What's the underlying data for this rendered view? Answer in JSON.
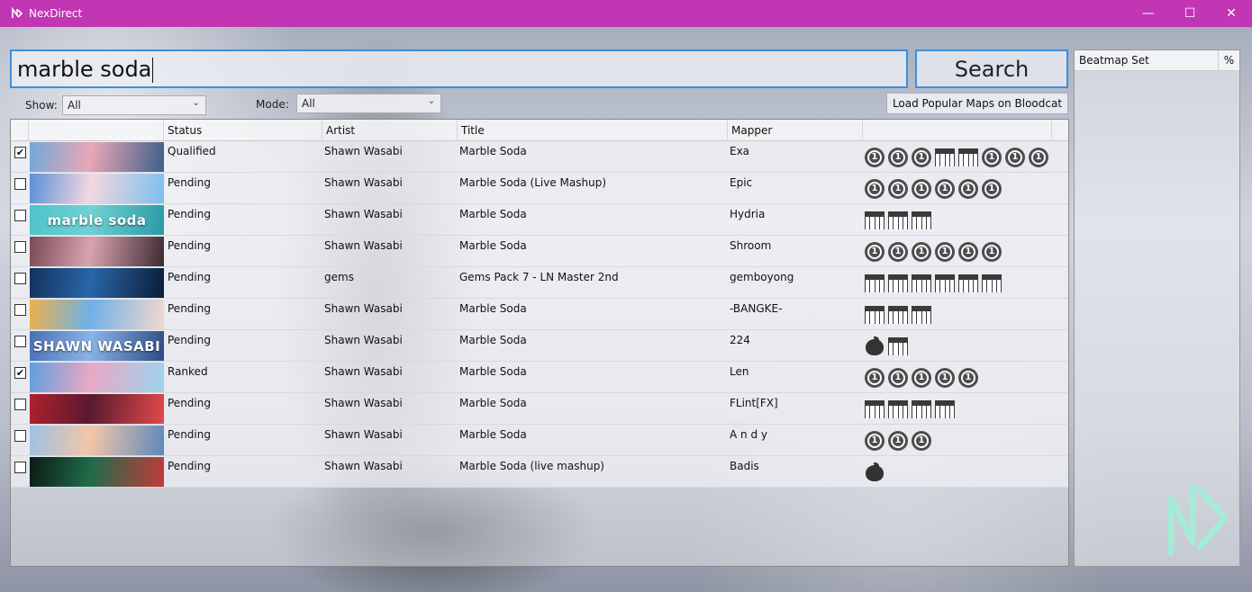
{
  "window": {
    "title": "NexDirect",
    "minimize": "—",
    "maximize": "☐",
    "close": "✕"
  },
  "search": {
    "value": "marble soda",
    "button_label": "Search"
  },
  "filters": {
    "show_label": "Show:",
    "show_value": "All",
    "mode_label": "Mode:",
    "mode_value": "All",
    "load_popular_label": "Load Popular Maps on Bloodcat"
  },
  "grid": {
    "columns": [
      "Status",
      "Artist",
      "Title",
      "Mapper"
    ],
    "rows": [
      {
        "checked": true,
        "status": "Qualified",
        "artist": "Shawn Wasabi",
        "title": "Marble Soda",
        "mapper": "Exa",
        "thumb_colors": [
          "#6fa9d8",
          "#e9a7b6",
          "#3d5f8a"
        ],
        "thumb_text": "",
        "diffs": [
          "std",
          "std",
          "std",
          "mania",
          "mania",
          "std",
          "std",
          "std"
        ]
      },
      {
        "checked": false,
        "status": "Pending",
        "artist": "Shawn Wasabi",
        "title": "Marble Soda (Live Mashup)",
        "mapper": "Epic",
        "thumb_colors": [
          "#5b8fd6",
          "#f2d7e1",
          "#7cc0ec"
        ],
        "thumb_text": "",
        "diffs": [
          "std",
          "std",
          "std",
          "std",
          "std",
          "std"
        ]
      },
      {
        "checked": false,
        "status": "Pending",
        "artist": "Shawn Wasabi",
        "title": "Marble Soda",
        "mapper": "Hydria",
        "thumb_colors": [
          "#4cc3c9",
          "#6fd1d3",
          "#2a9aa6"
        ],
        "thumb_text": "marble soda",
        "diffs": [
          "mania",
          "mania",
          "mania"
        ]
      },
      {
        "checked": false,
        "status": "Pending",
        "artist": "Shawn Wasabi",
        "title": "Marble Soda",
        "mapper": "Shroom",
        "thumb_colors": [
          "#7a4a57",
          "#d8a3ae",
          "#3b2a33"
        ],
        "thumb_text": "",
        "diffs": [
          "std",
          "std",
          "std",
          "std",
          "std",
          "std"
        ]
      },
      {
        "checked": false,
        "status": "Pending",
        "artist": "gems",
        "title": "Gems Pack 7 - LN Master 2nd",
        "mapper": "gemboyong",
        "thumb_colors": [
          "#12325e",
          "#2a66a8",
          "#0b1d38"
        ],
        "thumb_text": "",
        "diffs": [
          "mania",
          "mania",
          "mania",
          "mania",
          "mania",
          "mania"
        ]
      },
      {
        "checked": false,
        "status": "Pending",
        "artist": "Shawn Wasabi",
        "title": "Marble Soda",
        "mapper": "-BANGKE-",
        "thumb_colors": [
          "#f0b04a",
          "#6fb1e6",
          "#f3d8d0"
        ],
        "thumb_text": "",
        "diffs": [
          "mania",
          "mania",
          "mania"
        ]
      },
      {
        "checked": false,
        "status": "Pending",
        "artist": "Shawn Wasabi",
        "title": "Marble Soda",
        "mapper": "224",
        "thumb_colors": [
          "#4a6fb5",
          "#89b4e6",
          "#2e4c86"
        ],
        "thumb_text": "SHAWN WASABI",
        "diffs": [
          "fruit",
          "mania"
        ]
      },
      {
        "checked": true,
        "status": "Ranked",
        "artist": "Shawn Wasabi",
        "title": "Marble Soda",
        "mapper": "Len",
        "thumb_colors": [
          "#5e9ee0",
          "#eaa8c4",
          "#9bd3ef"
        ],
        "thumb_text": "",
        "diffs": [
          "std",
          "std",
          "std",
          "std",
          "std"
        ]
      },
      {
        "checked": false,
        "status": "Pending",
        "artist": "Shawn Wasabi",
        "title": "Marble Soda",
        "mapper": "FLint[FX]",
        "thumb_colors": [
          "#b0202e",
          "#5a1a30",
          "#e24a4a"
        ],
        "thumb_text": "",
        "diffs": [
          "mania",
          "mania",
          "mania",
          "mania"
        ]
      },
      {
        "checked": false,
        "status": "Pending",
        "artist": "Shawn Wasabi",
        "title": "Marble Soda",
        "mapper": "A n d y",
        "thumb_colors": [
          "#9cc2e4",
          "#f2c6a8",
          "#5c88bd"
        ],
        "thumb_text": "",
        "diffs": [
          "std",
          "std",
          "std"
        ]
      },
      {
        "checked": false,
        "status": "Pending",
        "artist": "Shawn Wasabi",
        "title": "Marble Soda (live mashup)",
        "mapper": "Badis",
        "thumb_colors": [
          "#0d1a14",
          "#1f6b4a",
          "#c43a3a"
        ],
        "thumb_text": "",
        "diffs": [
          "fruit"
        ]
      }
    ]
  },
  "side_panel": {
    "col_beatmap_set": "Beatmap Set",
    "col_percent": "%"
  },
  "colors": {
    "titlebar": "#c236b4",
    "accent_border": "#3d8fd9",
    "logo": "#9ff0d6"
  }
}
